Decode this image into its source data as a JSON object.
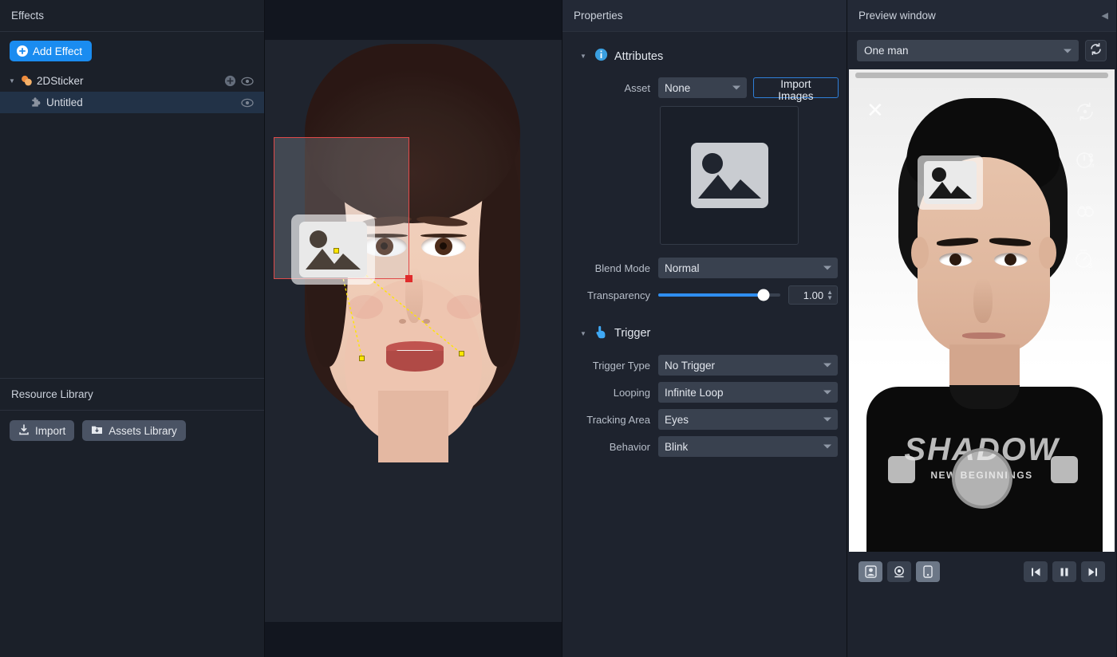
{
  "left_panel": {
    "header_title": "Effects",
    "add_effect_label": "Add Effect",
    "tree": [
      {
        "label": "2DSticker",
        "level": 0,
        "icon": "sticker-circles-icon",
        "selected": false,
        "has_add": true,
        "has_eye": true
      },
      {
        "label": "Untitled",
        "level": 1,
        "icon": "puzzle-piece-icon",
        "selected": true,
        "has_add": false,
        "has_eye": true
      }
    ],
    "resource_library": {
      "header_title": "Resource Library",
      "import_label": "Import",
      "assets_library_label": "Assets Library"
    }
  },
  "properties": {
    "header_title": "Properties",
    "attributes": {
      "section_label": "Attributes",
      "asset_label": "Asset",
      "asset_value": "None",
      "import_images_label": "Import Images",
      "thumbnail_icon": "image-placeholder-icon",
      "blend_mode_label": "Blend Mode",
      "blend_mode_value": "Normal",
      "transparency_label": "Transparency",
      "transparency_value": "1.00",
      "transparency_percent": 86
    },
    "trigger": {
      "section_label": "Trigger",
      "trigger_type_label": "Trigger Type",
      "trigger_type_value": "No Trigger",
      "looping_label": "Looping",
      "looping_value": "Infinite Loop",
      "tracking_area_label": "Tracking Area",
      "tracking_area_value": "Eyes",
      "behavior_label": "Behavior",
      "behavior_value": "Blink"
    }
  },
  "preview": {
    "header_title": "Preview window",
    "collapse_icon": "chevron-left-icon",
    "model_value": "One man",
    "refresh_icon": "refresh-icon",
    "overlay": {
      "close_icon": "close-icon",
      "flip_camera_icon": "flip-camera-icon",
      "timer_off_icon": "timer-off-icon",
      "beauty_icon": "beauty-icon",
      "countdown_3_icon": "countdown-3-icon",
      "shirt_text": "SHADOW",
      "shirt_subtext": "NEW BEGINNINGS"
    },
    "controls": {
      "left": [
        {
          "name": "photo-mode-button",
          "icon": "portrait-photo-icon",
          "active": true
        },
        {
          "name": "webcam-mode-button",
          "icon": "webcam-icon",
          "active": false
        },
        {
          "name": "phone-mode-button",
          "icon": "phone-icon",
          "active": true
        }
      ],
      "right": [
        {
          "name": "previous-button",
          "icon": "skip-previous-icon"
        },
        {
          "name": "pause-button",
          "icon": "pause-icon"
        },
        {
          "name": "next-button",
          "icon": "skip-next-icon"
        }
      ]
    }
  },
  "canvas": {
    "selection": {
      "handle_color": "#e02b2b",
      "border_color": "#e04a4a",
      "tracking_line_color": "#ffe600",
      "sticker_icon": "image-placeholder-icon"
    }
  },
  "colors": {
    "accent_blue": "#1a8cf0",
    "panel_bg": "#1e232e",
    "sidebar_bg": "#1b2029",
    "selected_row": "#223247",
    "sticker_icon_orange": "#f0a04b"
  }
}
